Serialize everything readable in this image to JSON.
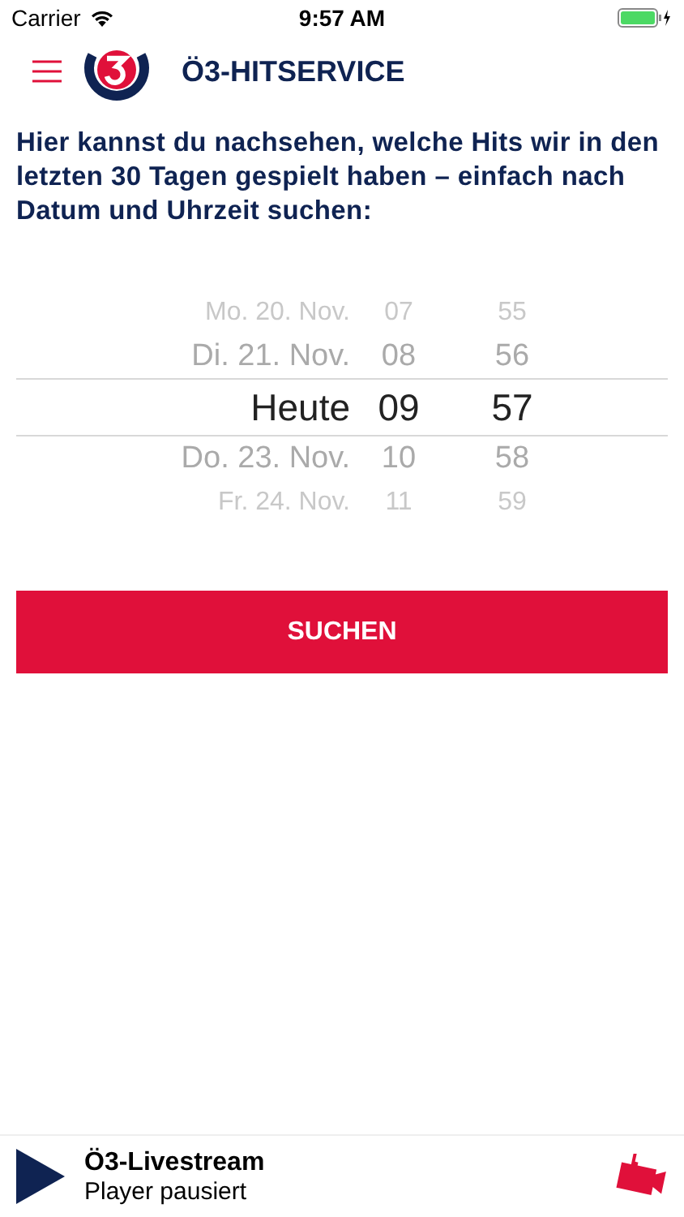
{
  "status_bar": {
    "carrier": "Carrier",
    "time": "9:57 AM"
  },
  "header": {
    "title": "Ö3-HITSERVICE"
  },
  "intro": "Hier kannst du nachsehen, welche Hits wir in den letzten 30 Tagen gespielt haben – einfach nach Datum und Uhrzeit suchen:",
  "picker": {
    "rows": [
      {
        "date": "Mo. 20. Nov.",
        "hour": "07",
        "minute": "55",
        "selected": false
      },
      {
        "date": "Di. 21. Nov.",
        "hour": "08",
        "minute": "56",
        "selected": false
      },
      {
        "date": "Heute",
        "hour": "09",
        "minute": "57",
        "selected": true
      },
      {
        "date": "Do. 23. Nov.",
        "hour": "10",
        "minute": "58",
        "selected": false
      },
      {
        "date": "Fr. 24. Nov.",
        "hour": "11",
        "minute": "59",
        "selected": false
      }
    ]
  },
  "search_button": "SUCHEN",
  "player": {
    "title": "Ö3-Livestream",
    "status": "Player pausiert"
  }
}
